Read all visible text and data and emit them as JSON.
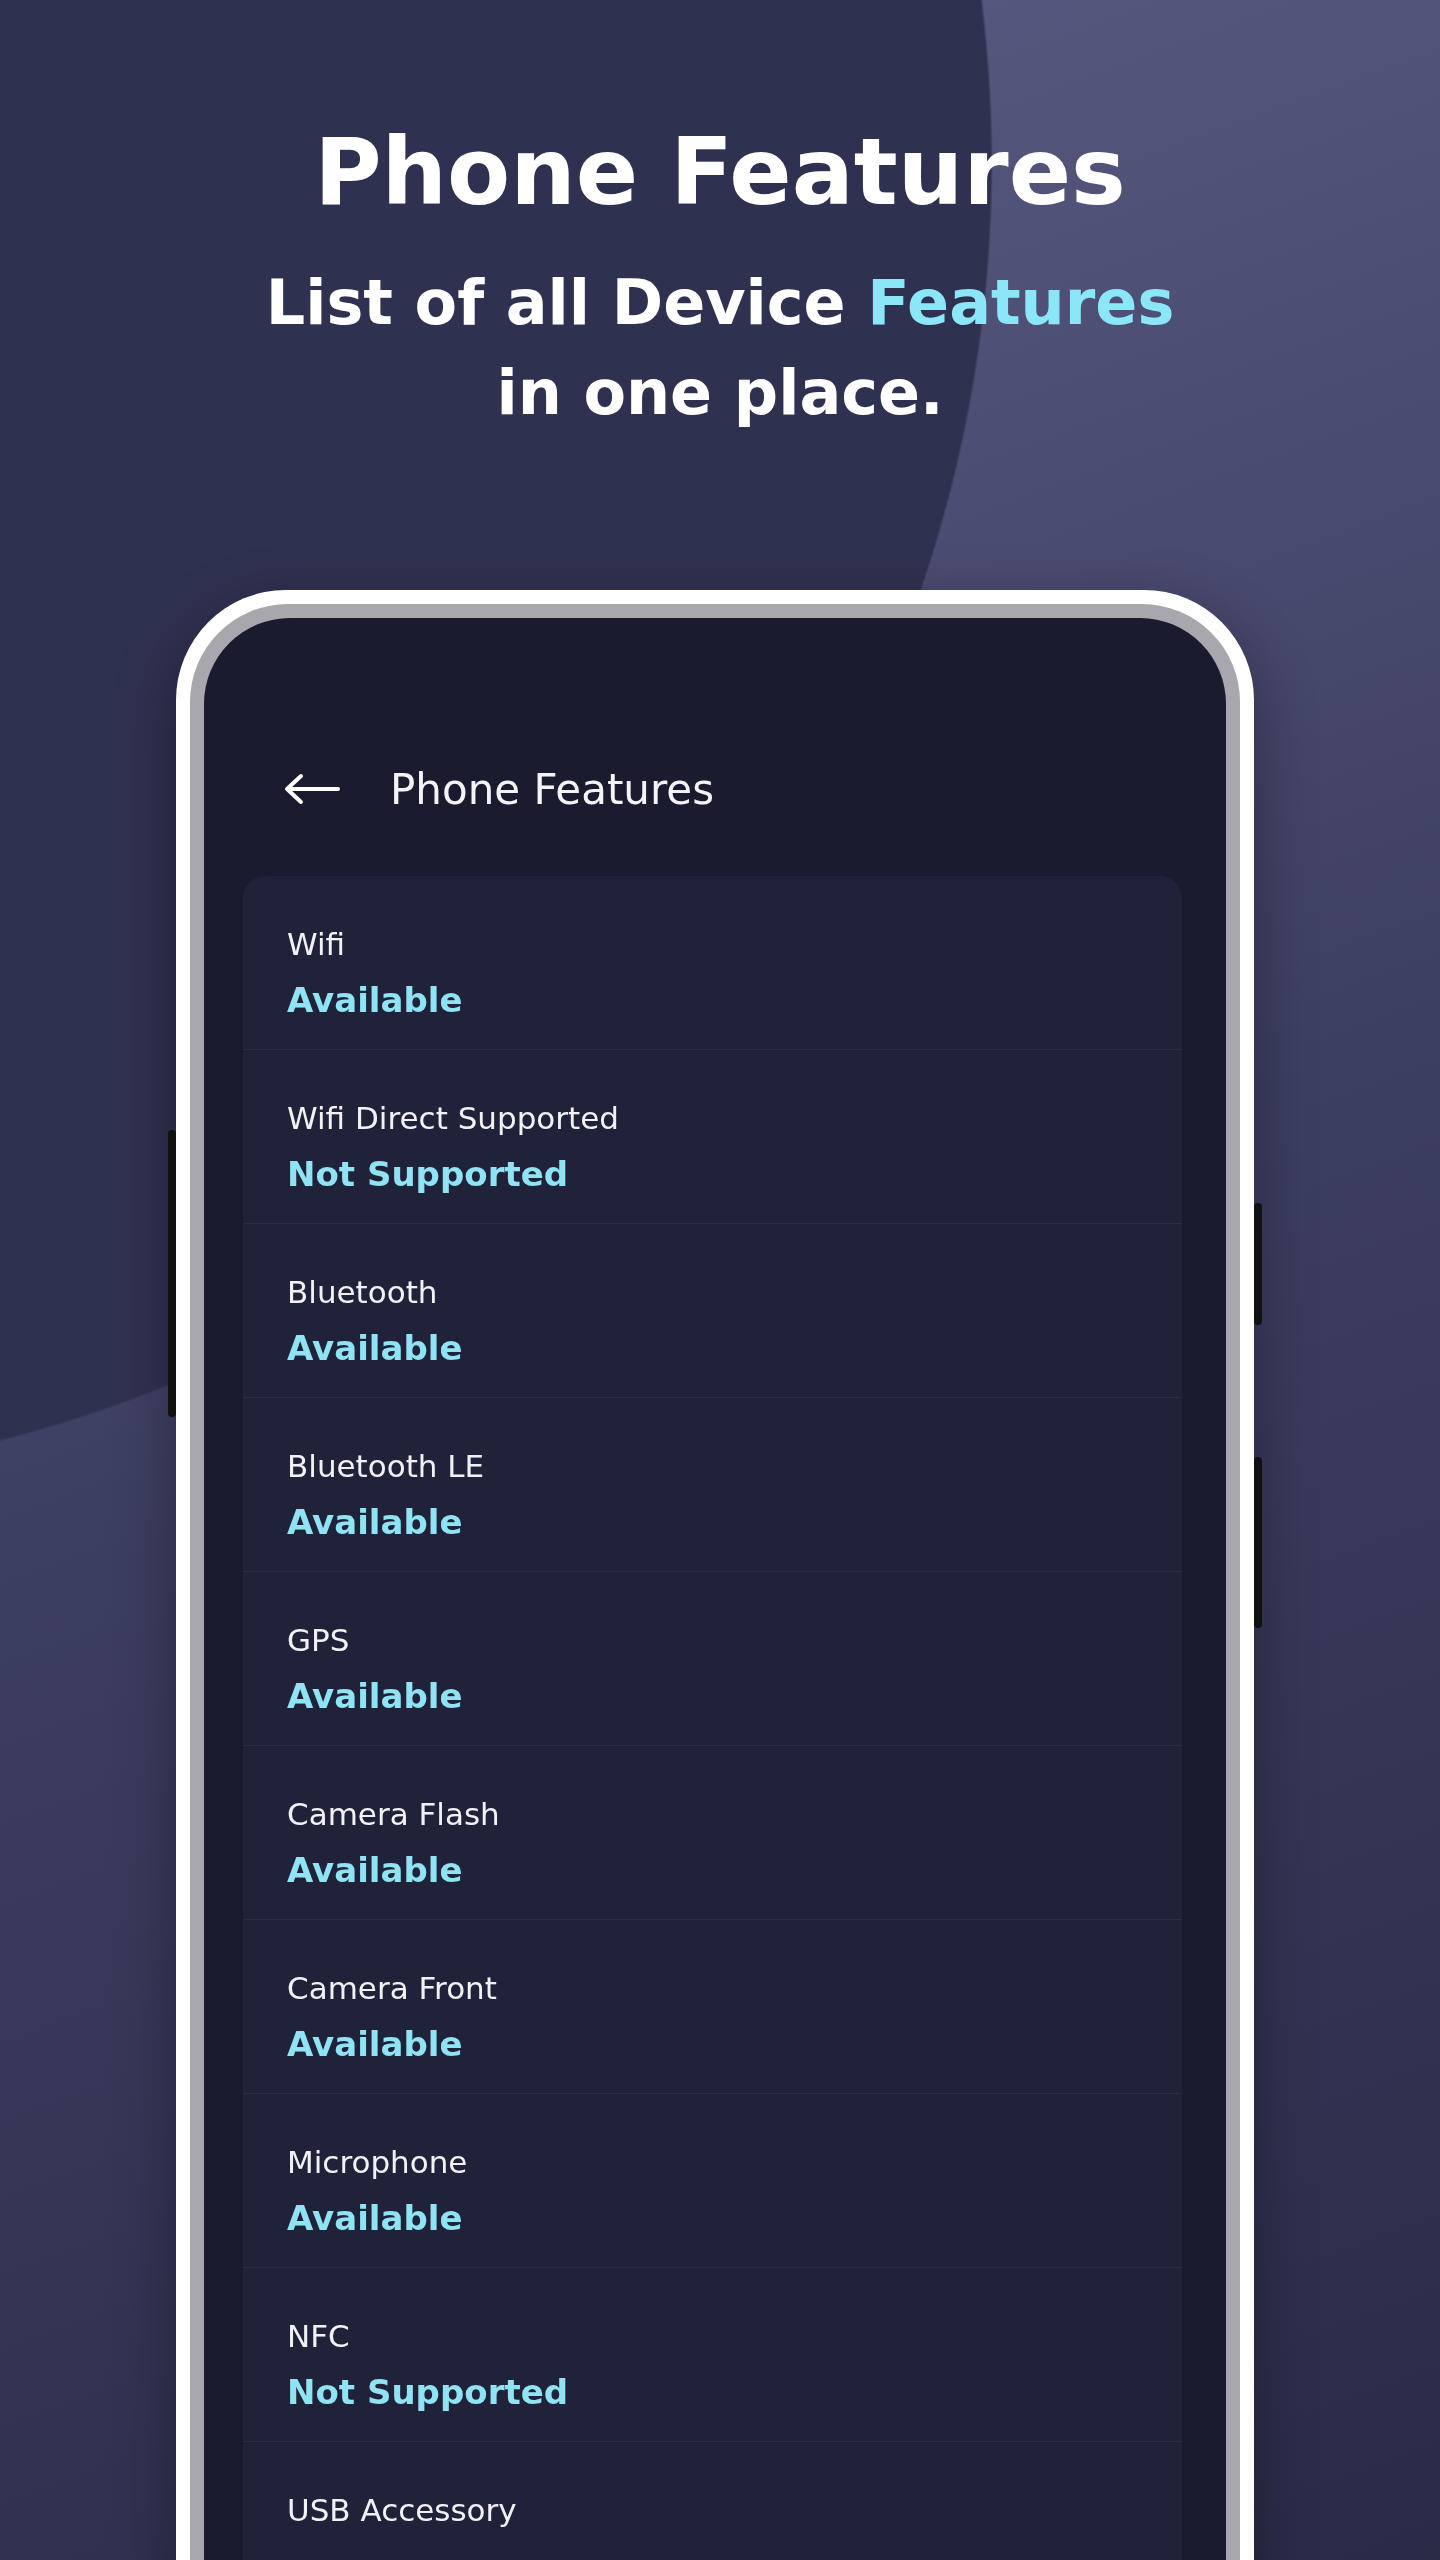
{
  "headline": {
    "title": "Phone Features",
    "subtitle": "List of all Device **Features** in one place."
  },
  "app_bar": {
    "title": "Phone Features"
  },
  "features": [
    {
      "name": "Wifi",
      "status": "Available"
    },
    {
      "name": "Wifi Direct Supported",
      "status": "Not Supported"
    },
    {
      "name": "Bluetooth",
      "status": "Available"
    },
    {
      "name": "Bluetooth LE",
      "status": "Available"
    },
    {
      "name": "GPS",
      "status": "Available"
    },
    {
      "name": "Camera Flash",
      "status": "Available"
    },
    {
      "name": "Camera Front",
      "status": "Available"
    },
    {
      "name": "Microphone",
      "status": "Available"
    },
    {
      "name": "NFC",
      "status": "Not Supported"
    },
    {
      "name": "USB Accessory"
    }
  ]
}
